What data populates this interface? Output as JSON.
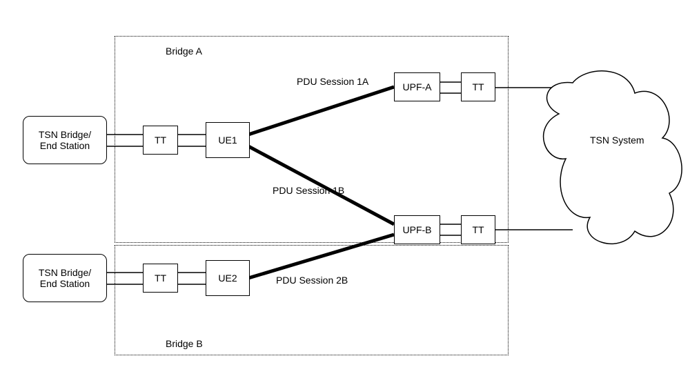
{
  "left_station_top": "TSN Bridge/\nEnd Station",
  "left_station_bottom": "TSN Bridge/\nEnd Station",
  "bridge_a": "Bridge A",
  "bridge_b": "Bridge B",
  "tt": "TT",
  "ue1": "UE1",
  "ue2": "UE2",
  "upf_a": "UPF-A",
  "upf_b": "UPF-B",
  "session_1a": "PDU Session 1A",
  "session_1b": "PDU Session 1B",
  "session_2b": "PDU Session 2B",
  "tsn_system": "TSN System"
}
